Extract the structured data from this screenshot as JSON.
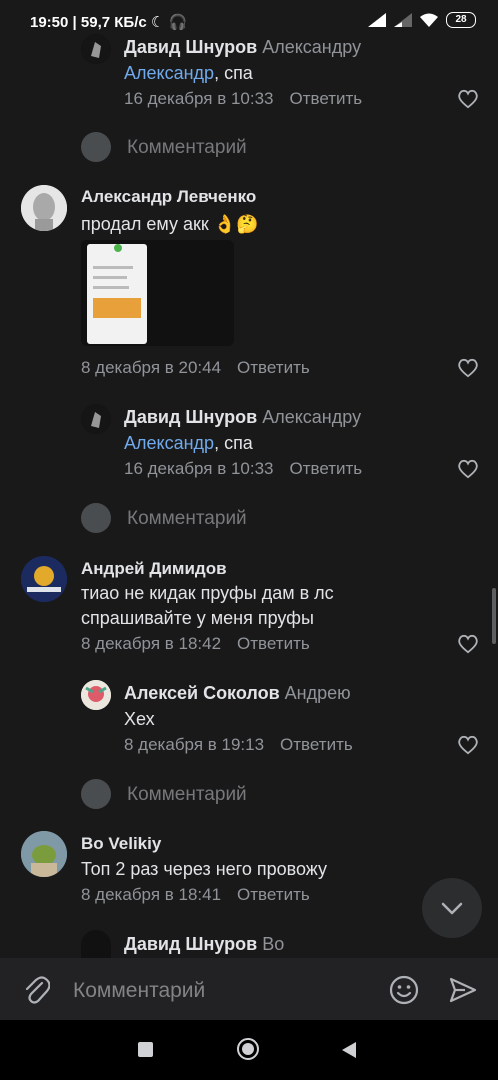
{
  "status": {
    "time_speed": "19:50 | 59,7 КБ/с",
    "battery": "28"
  },
  "comments": [
    {
      "name": "Давид Шнуров",
      "reply_to": "Александру",
      "mention": "Александр",
      "text_rest": ", спа",
      "date": "16 декабря в 10:33",
      "reply_label": "Ответить"
    },
    {
      "name": "Александр Левченко",
      "text": "продал ему акк 👌🤔",
      "date": "8 декабря в 20:44",
      "reply_label": "Ответить"
    },
    {
      "name": "Давид Шнуров",
      "reply_to": "Александру",
      "mention": "Александр",
      "text_rest": ", спа",
      "date": "16 декабря в 10:33",
      "reply_label": "Ответить"
    },
    {
      "name": "Андрей Димидов",
      "line1": "тиао не кидак пруфы дам в лс",
      "line2": "спрашивайте у меня пруфы",
      "date": "8 декабря в 18:42",
      "reply_label": "Ответить"
    },
    {
      "name": "Алексей Соколов",
      "reply_to": "Андрею",
      "text": "Хех",
      "date": "8 декабря в 19:13",
      "reply_label": "Ответить"
    },
    {
      "name": "Bo Velikiy",
      "text": "Топ 2 раз через него провожу",
      "date": "8 декабря в 18:41",
      "reply_label": "Ответить"
    },
    {
      "name": "Давид Шнуров",
      "reply_to": "Bo"
    }
  ],
  "comment_prompt": "Комментарий",
  "input": {
    "placeholder": "Комментарий"
  }
}
